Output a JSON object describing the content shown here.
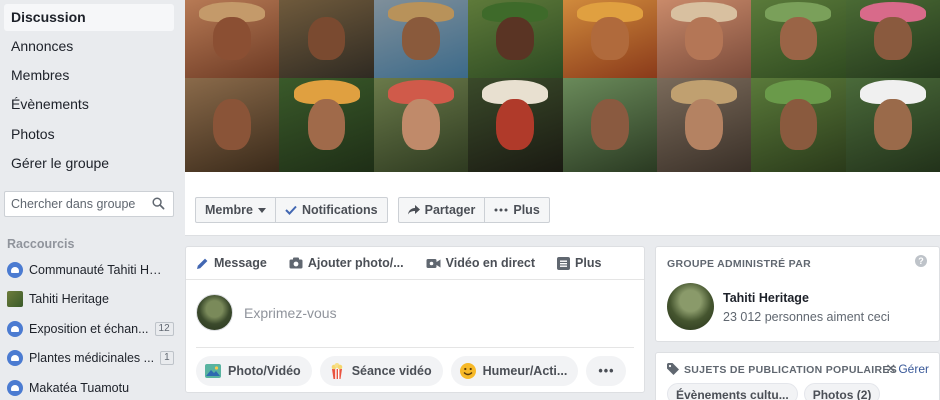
{
  "sidebar": {
    "nav": [
      {
        "label": "Discussion",
        "active": true
      },
      {
        "label": "Annonces",
        "active": false
      },
      {
        "label": "Membres",
        "active": false
      },
      {
        "label": "Évènements",
        "active": false
      },
      {
        "label": "Photos",
        "active": false
      },
      {
        "label": "Gérer le groupe",
        "active": false
      }
    ],
    "search_placeholder": "Chercher dans groupe",
    "shortcuts_title": "Raccourcis",
    "shortcuts": [
      {
        "label": "Communauté Tahiti He...",
        "count": "",
        "icon": "group-icon"
      },
      {
        "label": "Tahiti Heritage",
        "count": "",
        "icon": "page-photo-icon"
      },
      {
        "label": "Exposition et échan...",
        "count": "12",
        "icon": "group-icon"
      },
      {
        "label": "Plantes médicinales ...",
        "count": "1",
        "icon": "group-icon"
      },
      {
        "label": "Makatéa Tuamotu",
        "count": "",
        "icon": "group-icon"
      }
    ]
  },
  "cover": {
    "actions": {
      "member": "Membre",
      "notifications": "Notifications",
      "share": "Partager",
      "more": "Plus"
    }
  },
  "composer": {
    "tabs": {
      "message": "Message",
      "add_photo": "Ajouter photo/...",
      "live_video": "Vidéo en direct",
      "more": "Plus"
    },
    "placeholder": "Exprimez-vous",
    "pills": {
      "photo_video": "Photo/Vidéo",
      "watch_party": "Séance vidéo",
      "feeling": "Humeur/Acti...",
      "more": "•••"
    }
  },
  "admin_card": {
    "heading": "GROUPE ADMINISTRÉ PAR",
    "help": "?",
    "name": "Tahiti Heritage",
    "likes": "23 012 personnes aiment ceci"
  },
  "topics_card": {
    "heading": "SUJETS DE PUBLICATION POPULAIRES",
    "manage": "Gérer",
    "chips": [
      "Évènements cultu...",
      "Photos (2)"
    ]
  }
}
